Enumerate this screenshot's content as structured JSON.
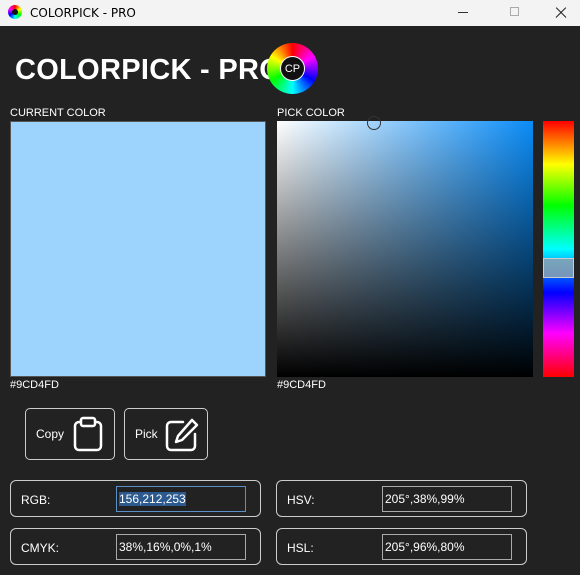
{
  "window": {
    "title": "COLORPICK - PRO"
  },
  "header": {
    "app_title": "COLORPICK - PRO",
    "logo_text": "CP"
  },
  "current_color": {
    "label": "CURRENT COLOR",
    "hex": "#9CD4FD",
    "swatch_color": "#9CD4FD"
  },
  "pick_color": {
    "label": "PICK COLOR",
    "hex": "#9CD4FD"
  },
  "buttons": {
    "copy": "Copy",
    "pick": "Pick"
  },
  "fields": {
    "rgb": {
      "label": "RGB:",
      "value": "156,212,253"
    },
    "hsv": {
      "label": "HSV:",
      "value": "205°,38%,99%"
    },
    "cmyk": {
      "label": "CMYK:",
      "value": "38%,16%,0%,1%"
    },
    "hsl": {
      "label": "HSL:",
      "value": "205°,96%,80%"
    }
  }
}
